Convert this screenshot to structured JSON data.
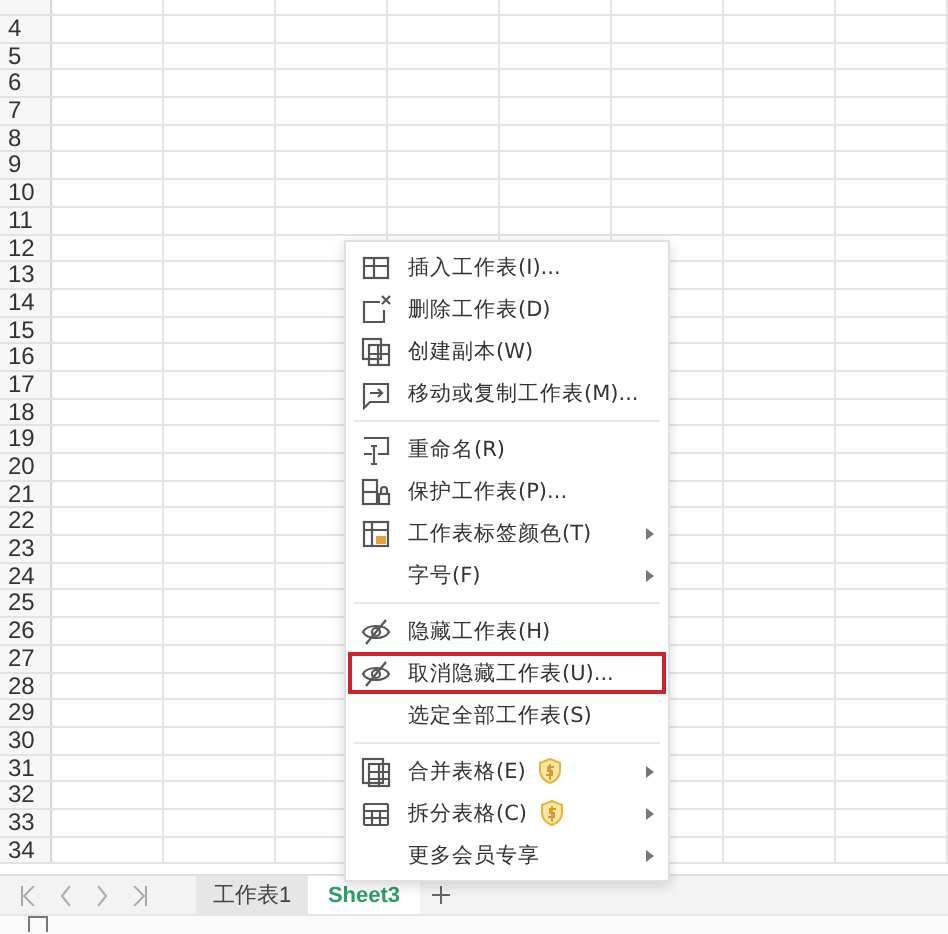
{
  "rows": [
    "4",
    "5",
    "6",
    "7",
    "8",
    "9",
    "10",
    "11",
    "12",
    "13",
    "14",
    "15",
    "16",
    "17",
    "18",
    "19",
    "20",
    "21",
    "22",
    "23",
    "24",
    "25",
    "26",
    "27",
    "28",
    "29",
    "30",
    "31",
    "32",
    "33",
    "34"
  ],
  "context_menu": {
    "groups": [
      [
        {
          "label": "插入工作表(I)...",
          "kind": "insert",
          "submenu": false,
          "member": false,
          "highlighted": false
        },
        {
          "label": "删除工作表(D)",
          "kind": "delete",
          "submenu": false,
          "member": false,
          "highlighted": false
        },
        {
          "label": "创建副本(W)",
          "kind": "copy",
          "submenu": false,
          "member": false,
          "highlighted": false
        },
        {
          "label": "移动或复制工作表(M)...",
          "kind": "move",
          "submenu": false,
          "member": false,
          "highlighted": false
        }
      ],
      [
        {
          "label": "重命名(R)",
          "kind": "rename",
          "submenu": false,
          "member": false,
          "highlighted": false
        },
        {
          "label": "保护工作表(P)...",
          "kind": "protect",
          "submenu": false,
          "member": false,
          "highlighted": false
        },
        {
          "label": "工作表标签颜色(T)",
          "kind": "tabcolor",
          "submenu": true,
          "member": false,
          "highlighted": false
        },
        {
          "label": "字号(F)",
          "kind": "plain",
          "submenu": true,
          "member": false,
          "highlighted": false
        }
      ],
      [
        {
          "label": "隐藏工作表(H)",
          "kind": "hide",
          "submenu": false,
          "member": false,
          "highlighted": false
        },
        {
          "label": "取消隐藏工作表(U)...",
          "kind": "hide",
          "submenu": false,
          "member": false,
          "highlighted": true
        },
        {
          "label": "选定全部工作表(S)",
          "kind": "plain",
          "submenu": false,
          "member": false,
          "highlighted": false
        }
      ],
      [
        {
          "label": "合并表格(E)",
          "kind": "merge",
          "submenu": true,
          "member": true,
          "highlighted": false
        },
        {
          "label": "拆分表格(C)",
          "kind": "split",
          "submenu": true,
          "member": true,
          "highlighted": false
        },
        {
          "label": "更多会员专享",
          "kind": "plain",
          "submenu": true,
          "member": false,
          "highlighted": false
        }
      ]
    ]
  },
  "sheet_tabs": [
    {
      "label": "工作表1",
      "selected": false
    },
    {
      "label": "Sheet3",
      "selected": true
    }
  ]
}
